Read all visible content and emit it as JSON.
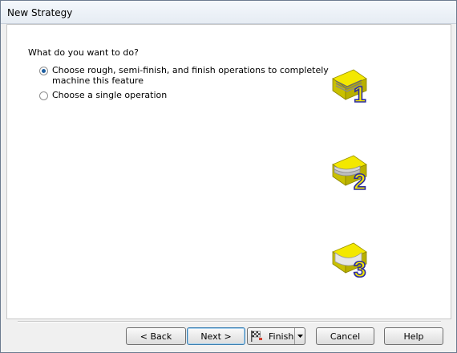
{
  "window": {
    "title": "New Strategy"
  },
  "main": {
    "question": "What do you want to do?",
    "options": [
      {
        "line1": "Choose rough, semi-finish, and finish operations to completely",
        "line2": "machine this feature",
        "checked": true
      },
      {
        "line1": "Choose a single operation",
        "checked": false
      }
    ],
    "stage_icons": [
      {
        "name": "stage-1-icon",
        "number": "1"
      },
      {
        "name": "stage-2-icon",
        "number": "2"
      },
      {
        "name": "stage-3-icon",
        "number": "3"
      }
    ]
  },
  "buttons": {
    "back": "< Back",
    "next": "Next >",
    "finish": "Finish",
    "cancel": "Cancel",
    "help": "Help"
  },
  "colors": {
    "icon_yellow": "#f3e800",
    "icon_number": "#f3e800",
    "icon_number_outline": "#2d2d9e",
    "accent": "#3c7fb1"
  }
}
